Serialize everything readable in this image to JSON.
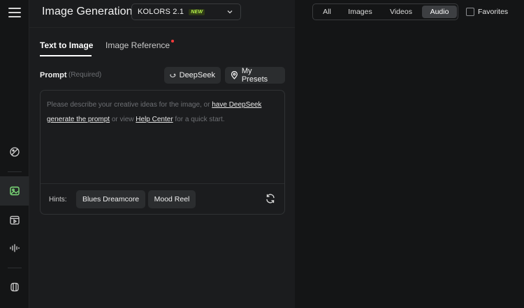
{
  "header": {
    "title": "Image Generation",
    "model": {
      "name": "KOLORS 2.1",
      "badge": "NEW"
    }
  },
  "tabs": [
    {
      "label": "Text to Image",
      "active": true
    },
    {
      "label": "Image Reference",
      "active": false,
      "has_notification_dot": true
    }
  ],
  "prompt": {
    "label": "Prompt",
    "required_note": "(Required)",
    "deepseek_button": "DeepSeek",
    "presets_button": "My Presets",
    "placeholder_parts": {
      "p1": "Please describe your creative ideas for the image, or ",
      "link1": "have DeepSeek generate the prompt",
      "p2": " or view ",
      "link2": "Help Center",
      "p3": " for a quick start."
    }
  },
  "hints": {
    "label": "Hints:",
    "chips": [
      "Blues Dreamcore",
      "Mood Reel"
    ]
  },
  "filters": {
    "options": [
      "All",
      "Images",
      "Videos",
      "Audio"
    ],
    "selected": "Audio",
    "favorites_label": "Favorites",
    "favorites_checked": false
  },
  "sidebar": {
    "items": [
      {
        "icon": "palette-icon",
        "active": false
      },
      {
        "icon": "image-icon",
        "active": true
      },
      {
        "icon": "video-icon",
        "active": false
      },
      {
        "icon": "audio-wave-icon",
        "active": false
      },
      {
        "icon": "assets-icon",
        "active": false
      }
    ]
  },
  "colors": {
    "accent_active_icon": "#7ee07a",
    "new_badge": "#b7f34a",
    "notification_dot": "#ff3b3b"
  }
}
